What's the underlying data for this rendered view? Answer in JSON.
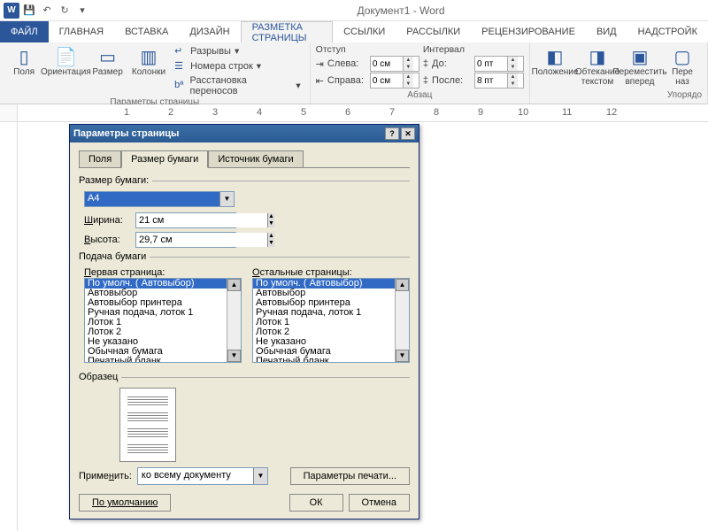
{
  "title": "Документ1 - Word",
  "qat": {
    "save": "💾",
    "undo": "↶",
    "redo": "↻"
  },
  "tabs": {
    "file": "ФАЙЛ",
    "home": "ГЛАВНАЯ",
    "insert": "ВСТАВКА",
    "design": "ДИЗАЙН",
    "layout": "РАЗМЕТКА СТРАНИЦЫ",
    "refs": "ССЫЛКИ",
    "mail": "РАССЫЛКИ",
    "review": "РЕЦЕНЗИРОВАНИЕ",
    "view": "ВИД",
    "addins": "НАДСТРОЙК"
  },
  "ribbon": {
    "margins": "Поля",
    "orientation": "Ориентация",
    "size": "Размер",
    "columns": "Колонки",
    "breaks": "Разрывы",
    "lineNumbers": "Номера строк",
    "hyphenation": "Расстановка переносов",
    "pageSetupGroup": "Параметры страницы",
    "indentHeader": "Отступ",
    "spacingHeader": "Интервал",
    "left": "Слева:",
    "right": "Справа:",
    "before": "До:",
    "after": "После:",
    "leftVal": "0 см",
    "rightVal": "0 см",
    "beforeVal": "0 пт",
    "afterVal": "8 пт",
    "paragraphGroup": "Абзац",
    "position": "Положение",
    "wrap": "Обтекание текстом",
    "forward": "Переместить вперед",
    "back": "Пере наз",
    "arrangeGroup": "Упорядо"
  },
  "dialog": {
    "title": "Параметры страницы",
    "tabFields": "Поля",
    "tabPaper": "Размер бумаги",
    "tabSource": "Источник бумаги",
    "paperSizeLabel": "Размер бумаги:",
    "paperSizeValue": "А4",
    "widthLabel": "Ширина:",
    "widthValue": "21 см",
    "heightLabel": "Высота:",
    "heightValue": "29,7 см",
    "feedLabel": "Подача бумаги",
    "firstPageLabel": "Первая страница:",
    "otherPagesLabel": "Остальные страницы:",
    "trayOptions": [
      "По умолч. ( Автовыбор)",
      "Автовыбор",
      "Автовыбор принтера",
      "Ручная подача, лоток 1",
      "Лоток 1",
      "Лоток 2",
      "Не указано",
      "Обычная бумага",
      "Печатный бланк"
    ],
    "sampleLabel": "Образец",
    "applyLabel": "Применить:",
    "applyValue": "ко всему документу",
    "printOptions": "Параметры печати...",
    "defaultBtn": "По умолчанию",
    "ok": "ОК",
    "cancel": "Отмена"
  }
}
